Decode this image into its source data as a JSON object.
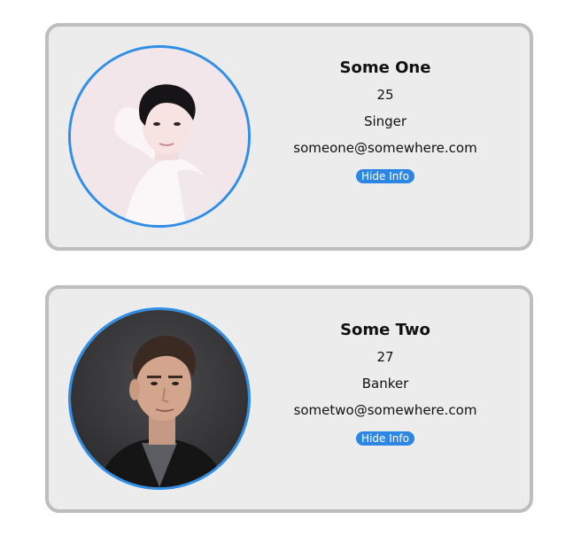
{
  "profiles": [
    {
      "name": "Some One",
      "age": "25",
      "job": "Singer",
      "email": "someone@somewhere.com",
      "button_label": "Hide Info"
    },
    {
      "name": "Some Two",
      "age": "27",
      "job": "Banker",
      "email": "sometwo@somewhere.com",
      "button_label": "Hide Info"
    }
  ],
  "colors": {
    "card_bg": "#ececec",
    "card_border": "#bebebe",
    "avatar_ring": "#2f8ee8",
    "button_bg": "#2b86e6"
  }
}
